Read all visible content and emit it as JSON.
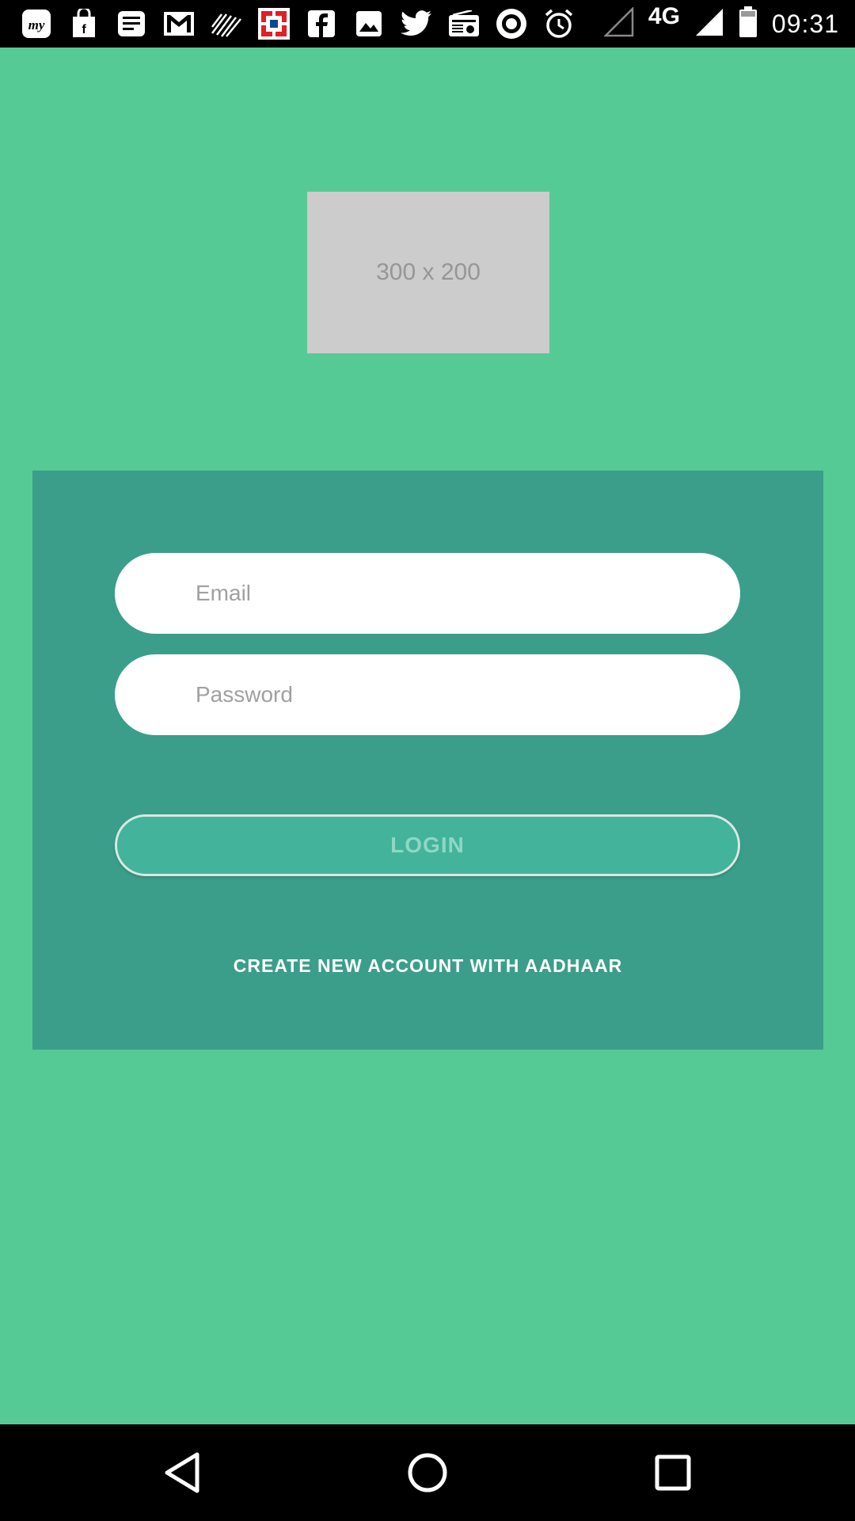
{
  "status_bar": {
    "notification_icons": [
      "myntra-icon",
      "shopping-bag-icon",
      "news-icon",
      "gmail-icon",
      "wave-icon",
      "hdfc-bank-icon",
      "facebook-icon",
      "image-icon",
      "twitter-icon",
      "radio-icon",
      "camera-shutter-icon",
      "alarm-icon"
    ],
    "network_label": "4G",
    "time": "09:31"
  },
  "logo": {
    "placeholder_text": "300 x 200"
  },
  "login_form": {
    "email": {
      "placeholder": "Email",
      "value": ""
    },
    "password": {
      "placeholder": "Password",
      "value": ""
    },
    "login_label": "LOGIN",
    "create_account_label": "CREATE NEW ACCOUNT WITH AADHAAR"
  },
  "colors": {
    "background": "#56ca95",
    "card": "#3b9e8a",
    "login_button": "#43b39b"
  },
  "navigation_bar": {
    "buttons": [
      "back-icon",
      "home-icon",
      "recents-icon"
    ]
  }
}
